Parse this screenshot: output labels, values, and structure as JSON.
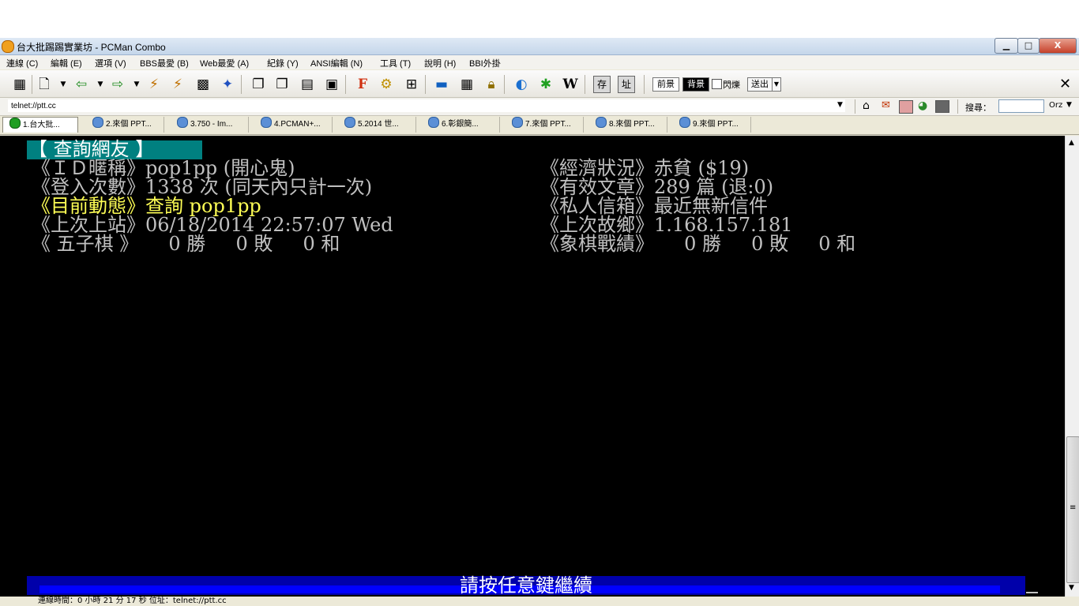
{
  "window": {
    "title": "台大批踢踢實業坊 - PCMan Combo",
    "minimize_label": "▁",
    "maximize_label": "□",
    "close_label": "X"
  },
  "menu": [
    "連線 (C)",
    "編輯 (E)",
    "選項 (V)",
    "BBS最愛 (B)",
    "Web最愛 (A)",
    "紀錄 (Y)",
    "ANSI編輯 (N)",
    "工具 (T)",
    "說明 (H)",
    "BBI外掛"
  ],
  "toolbar": {
    "font_label": "F",
    "wiki_label": "W",
    "save_label": "存",
    "address_label": "址",
    "fg_label": "前景",
    "bg_label": "背景",
    "blink_label": "閃爍",
    "send_label": "送出",
    "close_label": "✕"
  },
  "address": {
    "url": "telnet://ptt.cc",
    "search_label": "搜尋：",
    "search_value": "",
    "search_engine": "Orz"
  },
  "tabs": [
    "1.台大批...",
    "2.來個 PPT...",
    "3.750 - Im...",
    "4.PCMAN+...",
    "5.2014 世...",
    "6.彰銀簡...",
    "7.來個 PPT...",
    "8.來個 PPT...",
    "9.來個 PPT..."
  ],
  "terminal": {
    "header": "【 查詢網友 】",
    "lines": [
      {
        "left": "《ＩＤ暱稱》pop1pp (開心鬼)",
        "right": "《經濟狀況》赤貧 ($19)",
        "highlight": false
      },
      {
        "left": "《登入次數》1338 次 (同天內只計一次)",
        "right": "《有效文章》289 篇 (退:0)",
        "highlight": false
      },
      {
        "left": "《目前動態》查詢 pop1pp",
        "right": "《私人信箱》最近無新信件",
        "highlight": true
      },
      {
        "left": "《上次上站》06/18/2014 22:57:07 Wed",
        "right": "《上次故鄉》1.168.157.181",
        "highlight": false
      },
      {
        "left": "《 五子棋 》     0 勝     0 敗     0 和",
        "right": "《象棋戰績》     0 勝     0 敗     0 和",
        "highlight": false
      }
    ],
    "prompt": "請按任意鍵繼續"
  },
  "status": "連線時間：0 小時 21 分 17 秒     位址：telnet://ptt.cc",
  "colors": {
    "header_bg": "#008080",
    "header_fg": "#ffffff",
    "text": "#c0c0c0",
    "highlight": "#ffff55",
    "prompt_bar": "#0000aa",
    "prompt_band": "#0000ff"
  },
  "icons": [
    "app-icon",
    "new-connection-icon",
    "back-arrow-icon",
    "forward-arrow-icon",
    "disconnect-icon",
    "reconnect-icon",
    "settings-icon",
    "resize-icon",
    "lock-icon",
    "home-icon",
    "search-icon"
  ]
}
